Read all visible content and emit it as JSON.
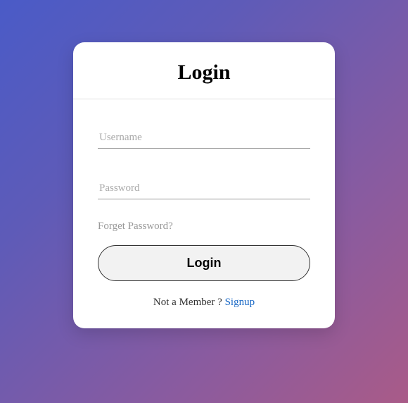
{
  "header": {
    "title": "Login"
  },
  "form": {
    "username_placeholder": "Username",
    "password_placeholder": "Password",
    "forget_label": "Forget Password?",
    "submit_label": "Login"
  },
  "footer": {
    "not_member_text": "Not a Member ? ",
    "signup_label": "Signup"
  }
}
